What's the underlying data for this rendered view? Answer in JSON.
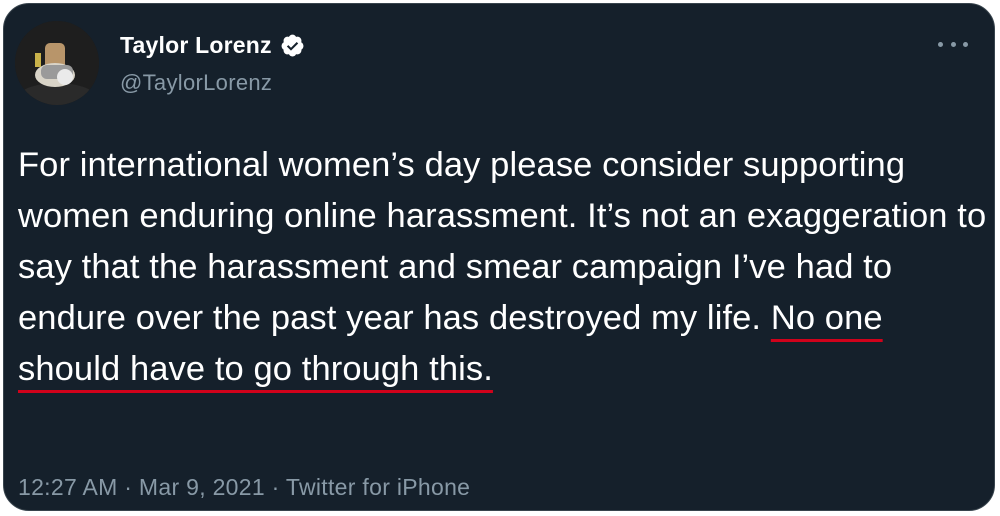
{
  "author": {
    "name": "Taylor Lorenz",
    "handle": "@TaylorLorenz",
    "verified": true,
    "avatar_icon": "profile-photo"
  },
  "tweet": {
    "text_plain": "For international women’s day please consider supporting women enduring online harassment. It’s not an exaggeration to say that the harassment and smear campaign I’ve had to endure over the past year has destroyed my life. ",
    "text_highlighted": "No one should have to go through this."
  },
  "meta": {
    "time": "12:27 AM",
    "date": "Mar 9, 2021",
    "source": "Twitter for iPhone",
    "separator": " · "
  },
  "colors": {
    "background": "#15202b",
    "border": "#38444d",
    "text": "#ffffff",
    "muted": "#8899a6",
    "verified_badge": "#ffffff",
    "underline": "#d0021b"
  },
  "icons": {
    "verified": "verified-badge-icon",
    "more": "more-options-icon"
  }
}
